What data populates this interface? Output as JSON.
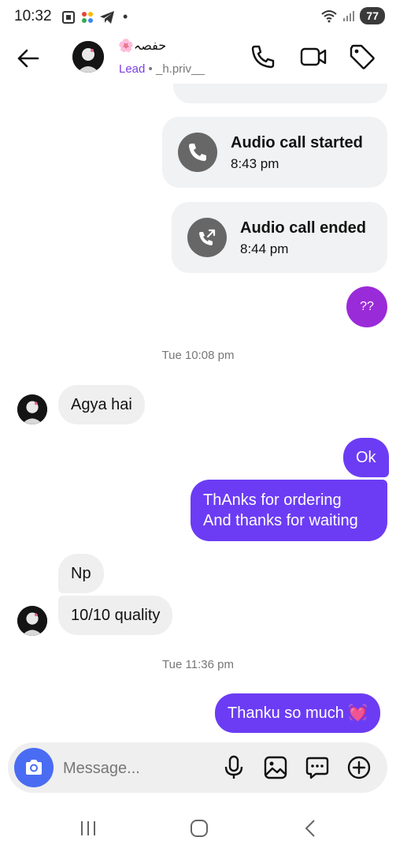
{
  "status_bar": {
    "time": "10:32",
    "battery": "77",
    "dot": "•"
  },
  "header": {
    "name": "🌸حفصہ",
    "lead_label": "Lead",
    "separator": "•",
    "username": "_h.priv__"
  },
  "calls": [
    {
      "title": "Audio call started",
      "time": "8:43 pm"
    },
    {
      "title": "Audio call ended",
      "time": "8:44 pm"
    }
  ],
  "messages": {
    "q": "??",
    "stamp1": "Tue 10:08 pm",
    "agya": "Agya hai",
    "ok": "Ok",
    "thanks_line1": "ThAnks for ordering",
    "thanks_line2": "And thanks for waiting",
    "np": "Np",
    "quality": "10/10 quality",
    "stamp2": "Tue 11:36 pm",
    "thanku": "Thanku so much 💓"
  },
  "composer": {
    "placeholder": "Message..."
  },
  "colors": {
    "outgoing": "#6c3cf4",
    "purple": "#9a2bd8",
    "camera": "#4a6cf2",
    "lead": "#7a3fe4"
  }
}
